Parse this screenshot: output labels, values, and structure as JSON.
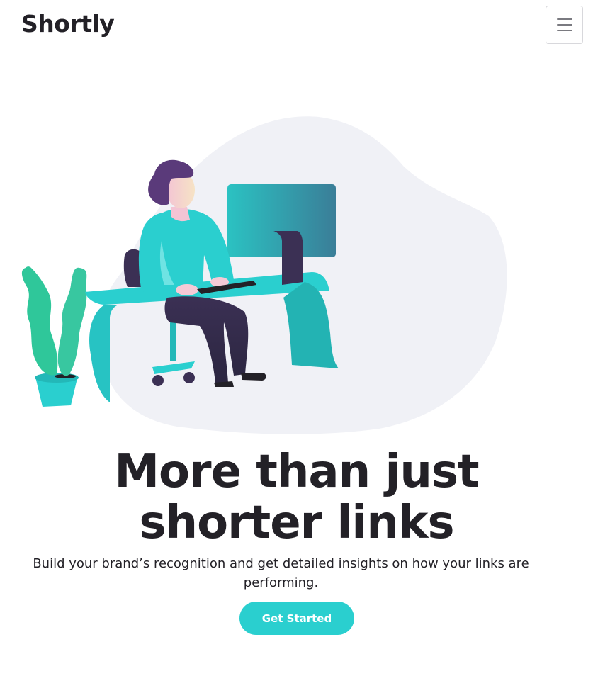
{
  "header": {
    "logo": "Shortly",
    "menu_icon": "hamburger-icon"
  },
  "hero": {
    "illustration": "person-working-at-desk-illustration",
    "headline": "More than just shorter links",
    "subtext": "Build your brand’s recognition and get detailed insights on how your links are performing.",
    "cta_label": "Get Started"
  },
  "colors": {
    "accent": "#2acfcf",
    "text_dark": "#232127",
    "blob": "#f0f1f6",
    "purple": "#3b3054"
  }
}
